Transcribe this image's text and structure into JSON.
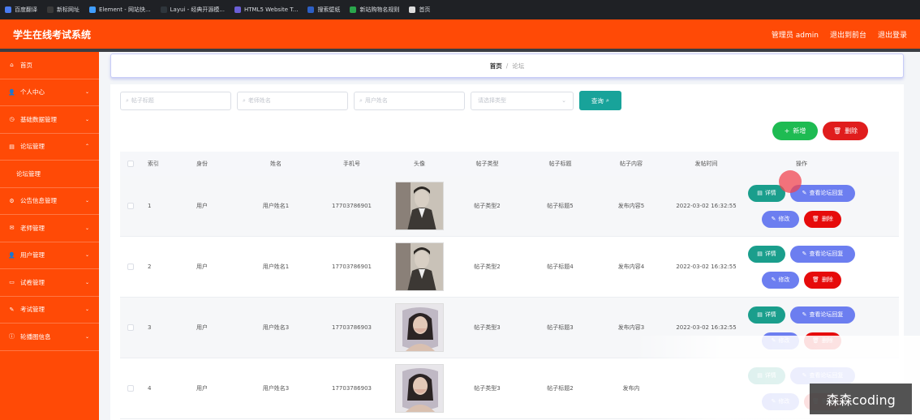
{
  "bookmarks": [
    {
      "label": "百度翻译",
      "color": "#4a7cf0"
    },
    {
      "label": "新标网址",
      "color": "#3a3a3a"
    },
    {
      "label": "Element - 网站快...",
      "color": "#409eff"
    },
    {
      "label": "Layui - 经典开源模...",
      "color": "#2f363c"
    },
    {
      "label": "HTML5 Website T...",
      "color": "#6b5fd6"
    },
    {
      "label": "搜索壁纸",
      "color": "#2d5fc4"
    },
    {
      "label": "新站购物名规则",
      "color": "#2aa64c"
    },
    {
      "label": "首页",
      "color": "#dddddd"
    }
  ],
  "header": {
    "title": "学生在线考试系统",
    "admin": "管理员 admin",
    "backend": "退出到前台",
    "logout": "退出登录"
  },
  "sidebar": {
    "items": [
      {
        "label": "首页",
        "icon": "home-icon",
        "glyph": "⌂",
        "chev": ""
      },
      {
        "label": "个人中心",
        "icon": "user-icon",
        "glyph": "👤",
        "chev": "⌄"
      },
      {
        "label": "基础数据管理",
        "icon": "clock-icon",
        "glyph": "◷",
        "chev": "⌄"
      },
      {
        "label": "论坛管理",
        "icon": "book-icon",
        "glyph": "▤",
        "chev": "⌃"
      },
      {
        "label": "论坛管理",
        "icon": "",
        "glyph": "",
        "chev": "",
        "sub": true
      },
      {
        "label": "公告信息管理",
        "icon": "gear-icon",
        "glyph": "⚙",
        "chev": "⌄"
      },
      {
        "label": "老师管理",
        "icon": "chat-icon",
        "glyph": "✉",
        "chev": "⌄"
      },
      {
        "label": "用户管理",
        "icon": "user-icon",
        "glyph": "👤",
        "chev": "⌄"
      },
      {
        "label": "试卷管理",
        "icon": "monitor-icon",
        "glyph": "▭",
        "chev": "⌄"
      },
      {
        "label": "考试管理",
        "icon": "pen-icon",
        "glyph": "✎",
        "chev": "⌄"
      },
      {
        "label": "轮播图信息",
        "icon": "info-icon",
        "glyph": "ⓘ",
        "chev": "⌄"
      }
    ]
  },
  "breadcrumb": {
    "home": "首页",
    "sep": "/",
    "current": "论坛"
  },
  "search": {
    "post_title_placeholder": "帖子标题",
    "teacher_placeholder": "老师姓名",
    "user_placeholder": "用户姓名",
    "type_placeholder": "请选择类型",
    "query_label": "查询"
  },
  "actions": {
    "add_label": "新增",
    "delete_label": "删除"
  },
  "table": {
    "headers": [
      "索引",
      "身份",
      "姓名",
      "手机号",
      "头像",
      "帖子类型",
      "帖子标题",
      "帖子内容",
      "发帖时间",
      "操作"
    ],
    "rows": [
      {
        "index": "1",
        "identity": "用户",
        "name": "用户姓名1",
        "phone": "17703786901",
        "avatar": "male",
        "type": "帖子类型2",
        "title": "帖子标题5",
        "content": "发布内容5",
        "time": "2022-03-02 16:32:55"
      },
      {
        "index": "2",
        "identity": "用户",
        "name": "用户姓名1",
        "phone": "17703786901",
        "avatar": "male",
        "type": "帖子类型2",
        "title": "帖子标题4",
        "content": "发布内容4",
        "time": "2022-03-02 16:32:55"
      },
      {
        "index": "3",
        "identity": "用户",
        "name": "用户姓名3",
        "phone": "17703786903",
        "avatar": "female",
        "type": "帖子类型3",
        "title": "帖子标题3",
        "content": "发布内容3",
        "time": "2022-03-02 16:32:55"
      },
      {
        "index": "4",
        "identity": "用户",
        "name": "用户姓名3",
        "phone": "17703786903",
        "avatar": "female",
        "type": "帖子类型3",
        "title": "帖子标题2",
        "content": "发布内",
        "time": ""
      }
    ],
    "ops": {
      "detail": "详情",
      "view_reply": "查看论坛回复",
      "edit": "修改",
      "delete": "删除"
    }
  },
  "watermark": "森森coding"
}
